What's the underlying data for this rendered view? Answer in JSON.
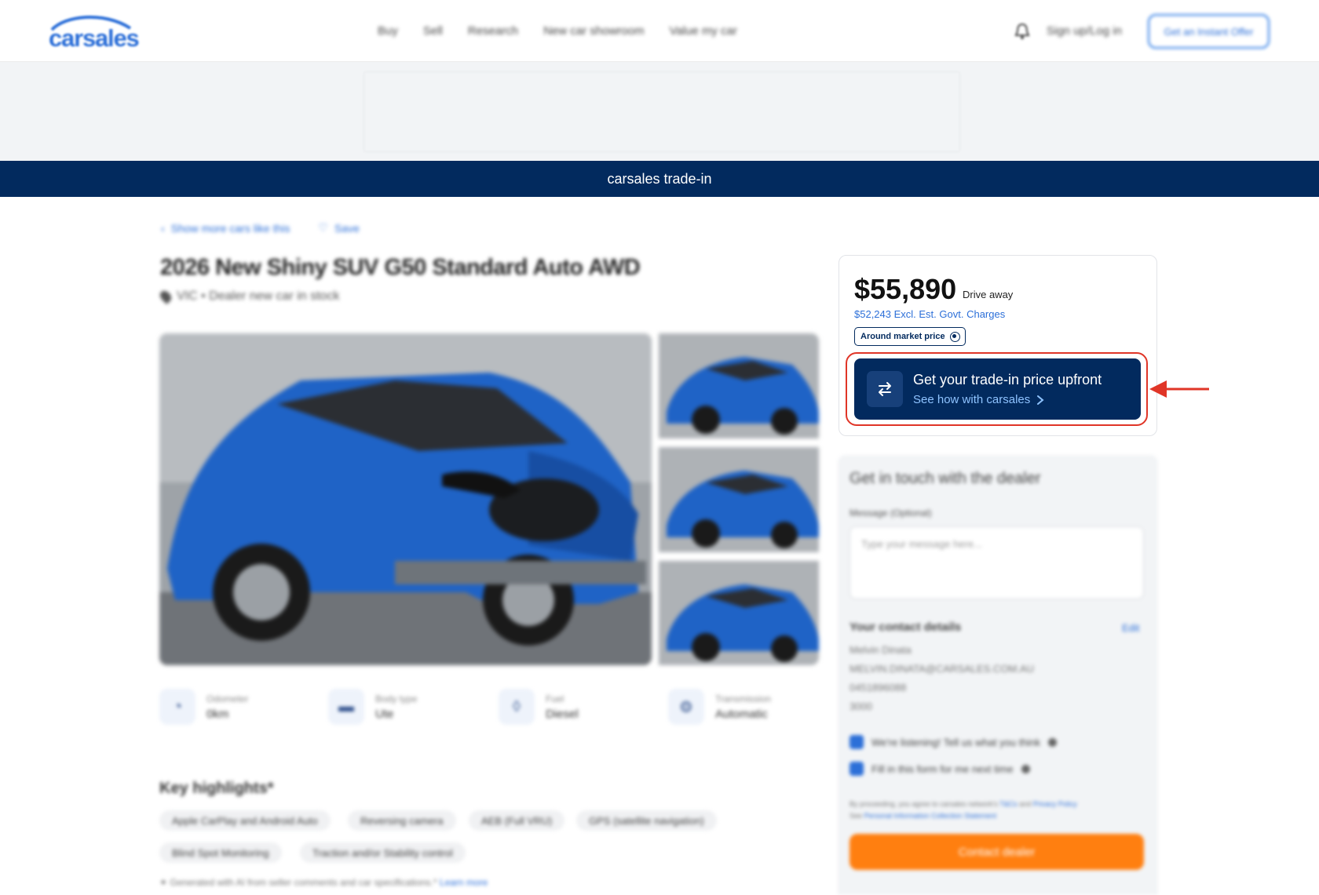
{
  "header": {
    "logo": "carsales",
    "nav": [
      "Buy",
      "Sell",
      "Research",
      "New car showroom",
      "Value my car"
    ],
    "login": "Sign up/Log in",
    "offer_button": "Get an Instant Offer",
    "icons": {
      "notifications": "bell-icon"
    }
  },
  "banner": {
    "text": "carsales trade-in"
  },
  "breadcrumb": {
    "back": "Show more cars like this",
    "save": "Save"
  },
  "listing": {
    "title": "2026 New Shiny SUV G50 Standard Auto AWD",
    "location": "VIC • Dealer new car in stock",
    "specs": [
      {
        "label": "Odometer",
        "value": "0km",
        "icon": "gauge-icon"
      },
      {
        "label": "Body type",
        "value": "Ute",
        "icon": "car-icon"
      },
      {
        "label": "Fuel",
        "value": "Diesel",
        "icon": "fuel-drop-icon"
      },
      {
        "label": "Transmission",
        "value": "Automatic",
        "icon": "gearshift-icon"
      }
    ],
    "key_highlights_title": "Key highlights*",
    "highlights": [
      "Apple CarPlay and Android Auto",
      "Reversing camera",
      "AEB (Full VRU)",
      "GPS (satellite navigation)",
      "Blind Spot Monitoring",
      "Traction and/or Stability control"
    ],
    "ai_note": "Generated with AI from seller comments and car specifications.*",
    "ai_note_link": "Learn more"
  },
  "price_card": {
    "price": "$55,890",
    "price_suffix": "Drive away",
    "excl": "$52,243 Excl. Est. Govt. Charges",
    "badge": "Around market price",
    "cta_title": "Get your trade-in price upfront",
    "cta_subtitle": "See how with carsales",
    "colors": {
      "cta_bg": "#022a5e",
      "highlight": "#e03527",
      "cta_link": "#8ec3ff"
    }
  },
  "contact": {
    "title": "Get in touch with the dealer",
    "message_label": "Message (Optional)",
    "message_placeholder": "Type your message here...",
    "details_title": "Your contact details",
    "edit": "Edit",
    "name": "Melvin Dinata",
    "email": "MELVIN.DINATA@CARSALES.COM.AU",
    "phone": "0451896088",
    "postcode": "3000",
    "check1": "We're listening! Tell us what you think",
    "check2": "Fill in this form for me next time",
    "legal_1": "By proceeding, you agree to carsales network's",
    "legal_tcs": "T&Cs",
    "legal_and": "and",
    "legal_privacy": "Privacy Policy",
    "legal_2": "See",
    "legal_pic": "Personal Information Collection Statement",
    "button": "Contact dealer",
    "button_color": "#ff7f10"
  }
}
